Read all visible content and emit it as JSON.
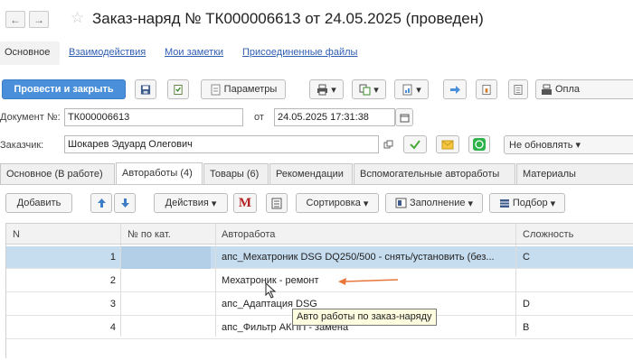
{
  "window": {
    "title": "Заказ-наряд № ТК000006613 от 24.05.2025 (проведен)",
    "back_icon": "←",
    "forward_icon": "→",
    "star_icon": "☆"
  },
  "subtabs": {
    "main": "Основное",
    "links": [
      "Взаимодействия",
      "Мои заметки",
      "Присоединенные файлы"
    ]
  },
  "toolbar": {
    "post_close": "Провести и закрыть",
    "params": "Параметры",
    "pay": "Опла"
  },
  "form": {
    "doc_label": "Документ №:",
    "doc_value": "ТК000006613",
    "from_label": "от",
    "date_value": "24.05.2025 17:31:38",
    "customer_label": "Заказчик:",
    "customer_value": "Шокарев Эдуард Олегович",
    "no_update": "Не обновлять"
  },
  "tabs": [
    "Основное (В работе)",
    "Автоработы (4)",
    "Товары (6)",
    "Рекомендации",
    "Вспомогательные автоработы",
    "Материалы"
  ],
  "table_toolbar": {
    "add": "Добавить",
    "actions": "Действия",
    "m_letter": "M",
    "sort": "Сортировка",
    "fill": "Заполнение",
    "pick": "Подбор"
  },
  "table": {
    "columns": [
      "N",
      "№ по кат.",
      "Авторабота",
      "Сложность"
    ],
    "rows": [
      {
        "n": "1",
        "cat": "",
        "work": "апс_Мехатроник DSG DQ250/500 - снять/установить (без...",
        "difficulty": "C"
      },
      {
        "n": "2",
        "cat": "",
        "work": "Мехатроник - ремонт",
        "difficulty": ""
      },
      {
        "n": "3",
        "cat": "",
        "work": "апс_Адаптация DSG",
        "difficulty": "D"
      },
      {
        "n": "4",
        "cat": "",
        "work": "апс_Фильтр АКПП - замена",
        "difficulty": "B"
      }
    ]
  },
  "tooltip": "Авто работы по заказ-наряду",
  "colors": {
    "primary": "#4a8fd9",
    "selected_row": "#c6dcef",
    "arrow": "#e8763a",
    "link": "#2f5eb3"
  }
}
